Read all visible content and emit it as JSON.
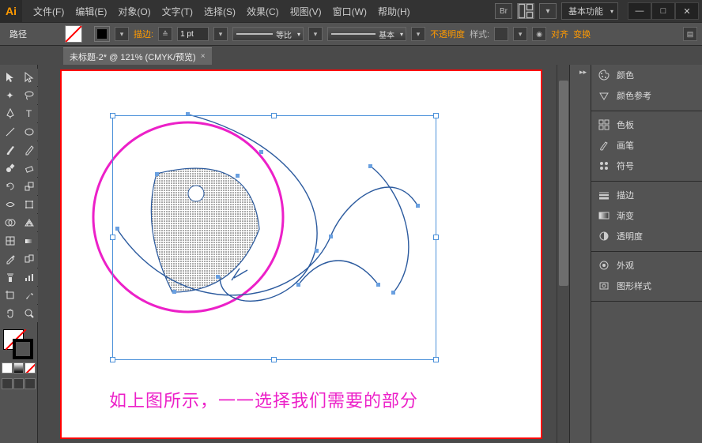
{
  "app_logo": "Ai",
  "menu": {
    "file": "文件(F)",
    "edit": "编辑(E)",
    "object": "对象(O)",
    "type": "文字(T)",
    "select": "选择(S)",
    "effect": "效果(C)",
    "view": "视图(V)",
    "window": "窗口(W)",
    "help": "帮助(H)"
  },
  "titlebar": {
    "bridge_label": "Br",
    "workspace": "基本功能"
  },
  "window_buttons": {
    "min": "—",
    "max": "□",
    "close": "✕"
  },
  "options": {
    "context_label": "路径",
    "stroke_label": "描边:",
    "stroke_value": "1 pt",
    "scale_label": "等比",
    "profile_label": "基本",
    "opacity_label": "不透明度",
    "style_label": "样式:",
    "align_label": "对齐",
    "transform_label": "变换"
  },
  "doc_tab": {
    "title": "未标题-2* @ 121% (CMYK/预览)",
    "close": "×"
  },
  "canvas_caption": "如上图所示，一一选择我们需要的部分",
  "panels": {
    "color": "颜色",
    "color_guide": "颜色参考",
    "swatches": "色板",
    "brushes": "画笔",
    "symbols": "符号",
    "stroke": "描边",
    "gradient": "渐变",
    "transparency": "透明度",
    "appearance": "外观",
    "graphic_styles": "图形样式"
  },
  "icons": {
    "palette": "palette",
    "grid": "grid"
  }
}
